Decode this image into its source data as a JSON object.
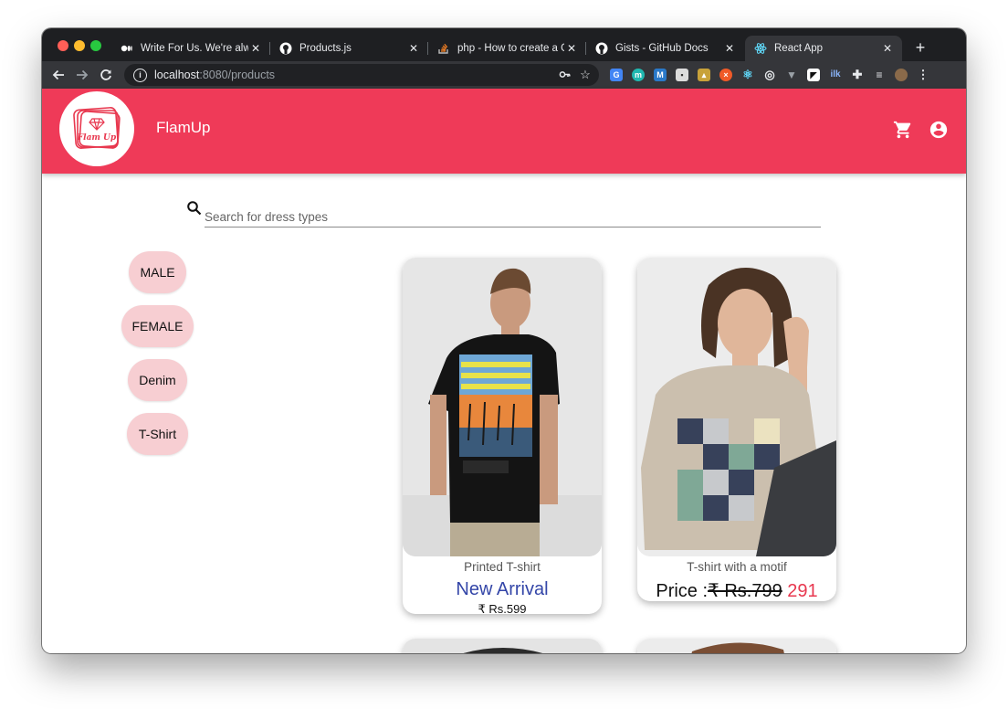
{
  "browser": {
    "tabs": [
      {
        "title": "Write For Us. We're always",
        "icon": "medium-icon"
      },
      {
        "title": "Products.js",
        "icon": "github-icon"
      },
      {
        "title": "php - How to create a Git",
        "icon": "stackoverflow-icon"
      },
      {
        "title": "Gists - GitHub Docs",
        "icon": "github-icon"
      },
      {
        "title": "React App",
        "icon": "react-icon",
        "active": true
      }
    ],
    "url_host": "localhost",
    "url_path": ":8080/products"
  },
  "app": {
    "brand": "FlamUp",
    "logo_text": "Flam Up",
    "accent_color": "#ef3a58",
    "chip_color": "#f7ced2"
  },
  "search": {
    "placeholder": "Search for dress types",
    "value": ""
  },
  "filters": [
    "MALE",
    "FEMALE",
    "Denim",
    "T-Shirt"
  ],
  "products": [
    {
      "name": "Printed T-shirt",
      "badge": "New Arrival",
      "price": "₹ Rs.599"
    },
    {
      "name": "T-shirt with a motif",
      "price_label": "Price :",
      "original_price": "₹ Rs.799",
      "sale_price": "291"
    }
  ]
}
